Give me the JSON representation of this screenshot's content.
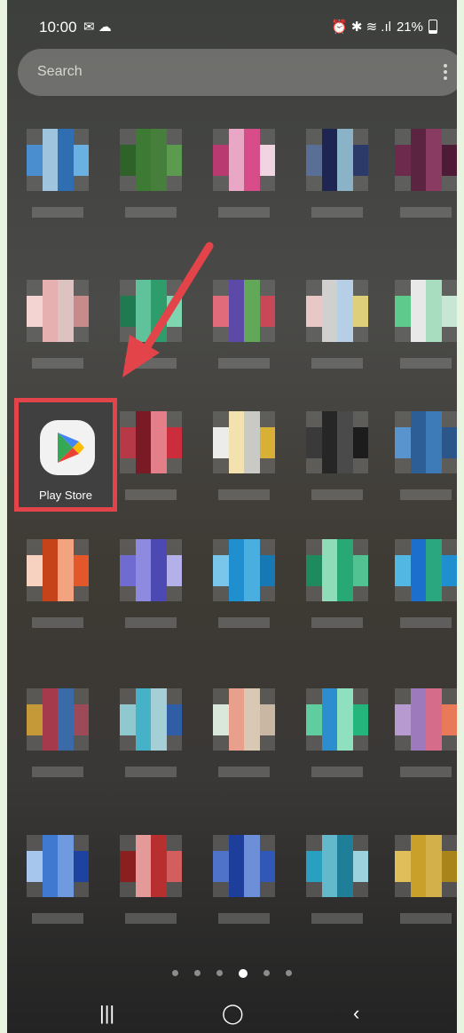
{
  "status": {
    "time": "10:00",
    "left_icons": "✉ ☁",
    "right_icons": "⏰ ✱ ≋ .ıl",
    "battery": "21%"
  },
  "search": {
    "placeholder": "Search"
  },
  "play_store": {
    "label": "Play Store"
  },
  "page_indicator": {
    "count": 6,
    "active_index": 3
  },
  "nav": {
    "recents": "|||",
    "home": "◯",
    "back": "‹"
  },
  "colors": {
    "annotation_red": "#e2444a"
  },
  "icons": {
    "kebab": "more-vert-icon",
    "arrow": "red-annotation-arrow-icon",
    "play": "google-play-logo-icon"
  }
}
